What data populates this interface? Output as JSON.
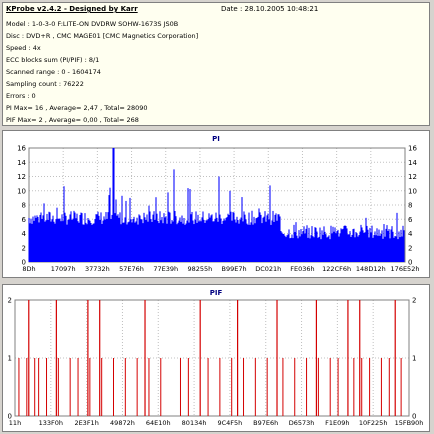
{
  "header": {
    "title": "KProbe v2.4.2 - Designed by Karr",
    "date": "Date : 28.10.2005 10:48:21",
    "lines": [
      "Model : 1-0-3-0 F:LITE-ON DVDRW SOHW-1673S JS0B",
      "Disc : DVD+R , CMC MAGE01 [CMC Magnetics Corporation]",
      "Speed : 4x",
      "ECC blocks sum (PI/PIF) : 8/1",
      "Scanned range : 0 - 1604174",
      "Sampling count : 76222",
      "Errors : 0",
      "PI Max= 16 , Average= 2,47 , Total= 28090",
      "PIF Max= 2 , Average= 0,00 , Total= 268"
    ]
  },
  "colors": {
    "pi": "#0000ff",
    "pif": "#d40000",
    "grid": "#c0c0c0",
    "title": "#000080"
  },
  "chart_data": [
    {
      "type": "bar",
      "title": "PI",
      "ylim": [
        0,
        16
      ],
      "yticks": [
        "0",
        "2",
        "4",
        "6",
        "8",
        "10",
        "12",
        "14",
        "16"
      ],
      "xtick_labels": [
        "8Dh",
        "17097h",
        "37732h",
        "57E76h",
        "77E39h",
        "98255h",
        "B99E7h",
        "DC021h",
        "FE036h",
        "122CF6h",
        "148D12h",
        "176E52h"
      ],
      "grid": true,
      "values_description_note": "",
      "segments": [
        {
          "from": 0.0,
          "to": 0.67,
          "level": 6,
          "peak": 11
        },
        {
          "from": 0.67,
          "to": 1.0,
          "level": 4,
          "peak": 7
        }
      ],
      "spikes": [
        {
          "pos": 0.225,
          "value": 16
        },
        {
          "pos": 0.385,
          "value": 13
        },
        {
          "pos": 0.505,
          "value": 12
        }
      ]
    },
    {
      "type": "bar",
      "title": "PIF",
      "ylim": [
        0,
        2
      ],
      "yticks": [
        "0",
        "1",
        "2"
      ],
      "xtick_labels": [
        "11h",
        "133F0h",
        "2E3F1h",
        "49872h",
        "64E10h",
        "80134h",
        "9C4F5h",
        "B97E6h",
        "D6573h",
        "F1E09h",
        "10F225h",
        "15FB90h"
      ],
      "grid": true,
      "twos": [
        0.035,
        0.105,
        0.185,
        0.215,
        0.33,
        0.47,
        0.565,
        0.665,
        0.765,
        0.845,
        0.875,
        0.965
      ],
      "ones": [
        0.01,
        0.03,
        0.05,
        0.06,
        0.08,
        0.11,
        0.14,
        0.16,
        0.19,
        0.22,
        0.25,
        0.28,
        0.31,
        0.34,
        0.37,
        0.42,
        0.44,
        0.49,
        0.52,
        0.55,
        0.58,
        0.61,
        0.64,
        0.68,
        0.71,
        0.74,
        0.77,
        0.8,
        0.82,
        0.86,
        0.88,
        0.9,
        0.93,
        0.95,
        0.98
      ]
    }
  ]
}
